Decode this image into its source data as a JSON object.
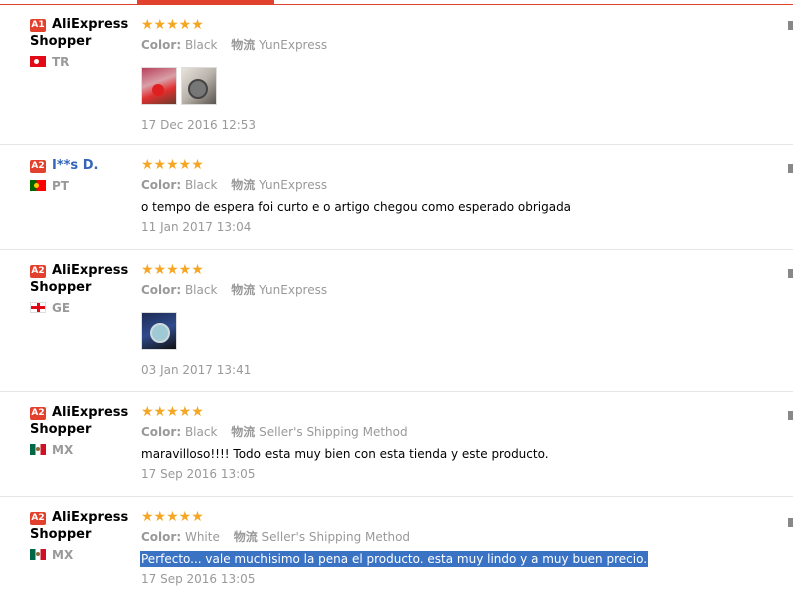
{
  "labels": {
    "color": "Color:",
    "shipping": "物流"
  },
  "stars": "★★★★★",
  "colors": {
    "accent": "#e2412e",
    "star": "#f5a623",
    "selected": "#3a72c4",
    "link": "#3366bb"
  },
  "reviews": [
    {
      "badge": "A1",
      "name": "AliExpress Shopper",
      "country_code": "TR",
      "flag_icon": "turkey-flag-icon",
      "rating": 5,
      "color": "Black",
      "shipping": "YunExpress",
      "feedback": "",
      "photos": [
        "photo-1",
        "photo-2"
      ],
      "date": "17 Dec 2016 12:53"
    },
    {
      "badge": "A2",
      "name": "I**s D.",
      "country_code": "PT",
      "flag_icon": "portugal-flag-icon",
      "rating": 5,
      "color": "Black",
      "shipping": "YunExpress",
      "feedback": "o tempo de espera foi curto e o artigo chegou como esperado obrigada",
      "photos": [],
      "date": "11 Jan 2017 13:04"
    },
    {
      "badge": "A2",
      "name": "AliExpress Shopper",
      "country_code": "GE",
      "flag_icon": "georgia-flag-icon",
      "rating": 5,
      "color": "Black",
      "shipping": "YunExpress",
      "feedback": "",
      "photos": [
        "photo-3"
      ],
      "date": "03 Jan 2017 13:41"
    },
    {
      "badge": "A2",
      "name": "AliExpress Shopper",
      "country_code": "MX",
      "flag_icon": "mexico-flag-icon",
      "rating": 5,
      "color": "Black",
      "shipping": "Seller's Shipping Method",
      "feedback": "maravilloso!!!! Todo esta muy bien con esta tienda y este producto.",
      "photos": [],
      "date": "17 Sep 2016 13:05"
    },
    {
      "badge": "A2",
      "name": "AliExpress Shopper",
      "country_code": "MX",
      "flag_icon": "mexico-flag-icon",
      "rating": 5,
      "color": "White",
      "shipping": "Seller's Shipping Method",
      "feedback": "Perfecto... vale muchisimo la pena el producto. esta muy lindo y a muy buen precio.",
      "feedback_selected": true,
      "photos": [],
      "date": "17 Sep 2016 13:05"
    }
  ]
}
